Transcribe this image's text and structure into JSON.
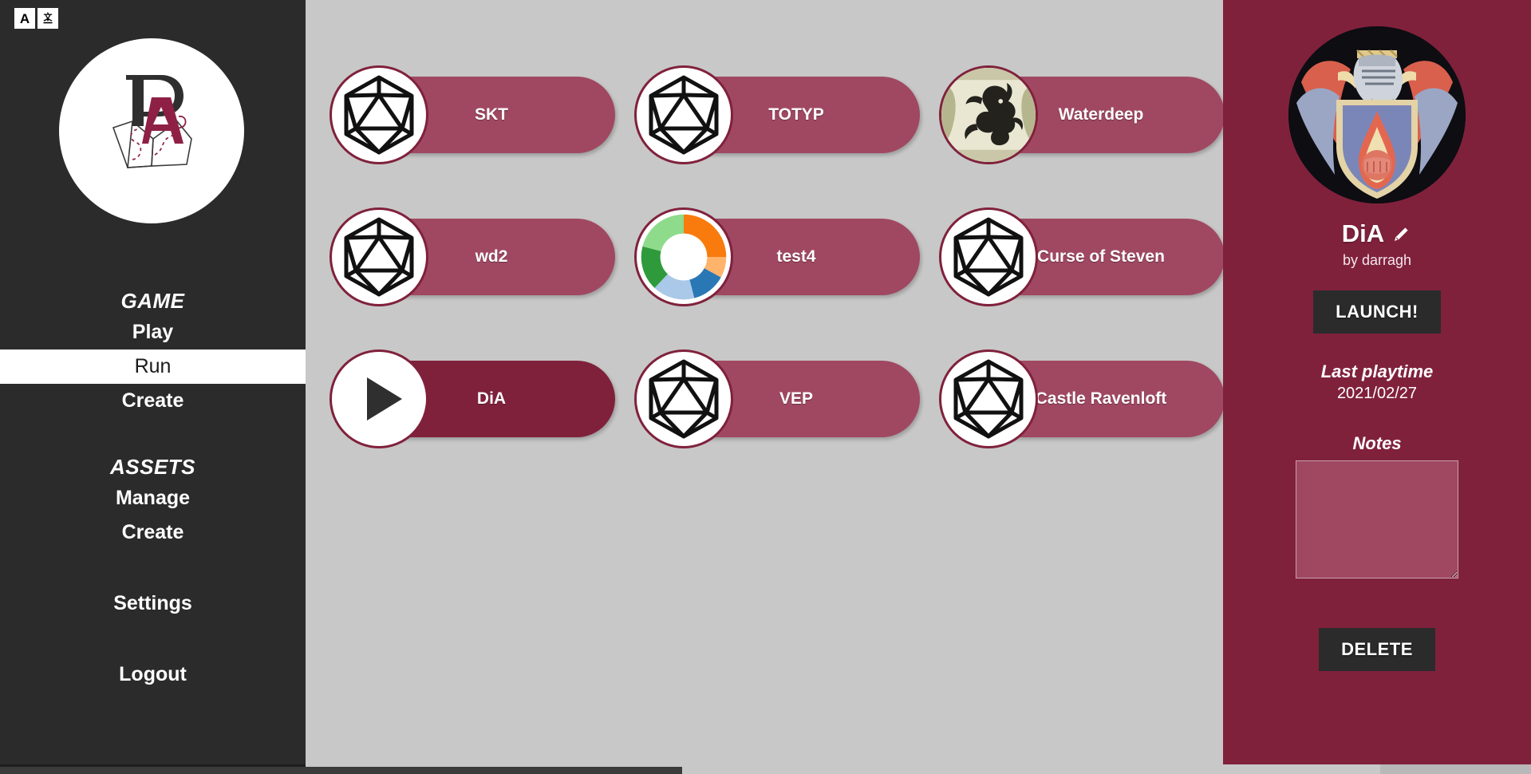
{
  "sidebar": {
    "lang_buttons": [
      {
        "name": "language-a",
        "label": "A"
      },
      {
        "name": "language-translate",
        "label": "文"
      }
    ],
    "logo_alt": "PA map logo",
    "groups": [
      {
        "label": "GAME",
        "items": [
          {
            "label": "Play",
            "active": false
          },
          {
            "label": "Run",
            "active": true
          },
          {
            "label": "Create",
            "active": false
          }
        ]
      },
      {
        "label": "ASSETS",
        "items": [
          {
            "label": "Manage",
            "active": false
          },
          {
            "label": "Create",
            "active": false
          }
        ]
      }
    ],
    "settings_label": "Settings",
    "logout_label": "Logout"
  },
  "main": {
    "games": [
      {
        "label": "SKT",
        "avatar": "d20",
        "selected": false
      },
      {
        "label": "TOTYP",
        "avatar": "d20",
        "selected": false
      },
      {
        "label": "Waterdeep",
        "avatar": "dragon",
        "selected": false
      },
      {
        "label": "wd2",
        "avatar": "d20",
        "selected": false
      },
      {
        "label": "test4",
        "avatar": "donut",
        "selected": false
      },
      {
        "label": "Curse of Steven",
        "avatar": "d20",
        "selected": false
      },
      {
        "label": "DiA",
        "avatar": "play",
        "selected": true
      },
      {
        "label": "VEP",
        "avatar": "d20",
        "selected": false
      },
      {
        "label": "Castle Ravenloft",
        "avatar": "d20",
        "selected": false
      }
    ]
  },
  "detail": {
    "avatar_alt": "heraldic coat of arms with helm shield flame and fist",
    "title": "DiA",
    "edit_icon": "pencil-icon",
    "author": "by darragh",
    "launch_label": "LAUNCH!",
    "last_playtime_label": "Last playtime",
    "last_playtime_value": "2021/02/27",
    "notes_label": "Notes",
    "notes_value": "",
    "notes_placeholder": "",
    "delete_label": "DELETE"
  },
  "colors": {
    "sidebar_bg": "#2b2b2b",
    "main_bg": "#c8c8c8",
    "card_bg": "#a04861",
    "card_selected_bg": "#80213c",
    "panel_bg": "#80213c",
    "accent_border": "#80213c",
    "button_bg": "#2b2b2b"
  },
  "avatar_chart": {
    "type": "pie",
    "title": "test4 donut avatar",
    "categories": [
      "orange",
      "light-orange",
      "blue",
      "light-blue",
      "green",
      "light-green"
    ],
    "values": [
      25,
      8,
      13,
      16,
      17,
      21
    ],
    "colors": [
      "#f97b0e",
      "#ffb36b",
      "#2a77b5",
      "#aac8e8",
      "#2f9a3c",
      "#8fdb8c"
    ],
    "legend": "none",
    "inner_radius_ratio": 0.55
  }
}
